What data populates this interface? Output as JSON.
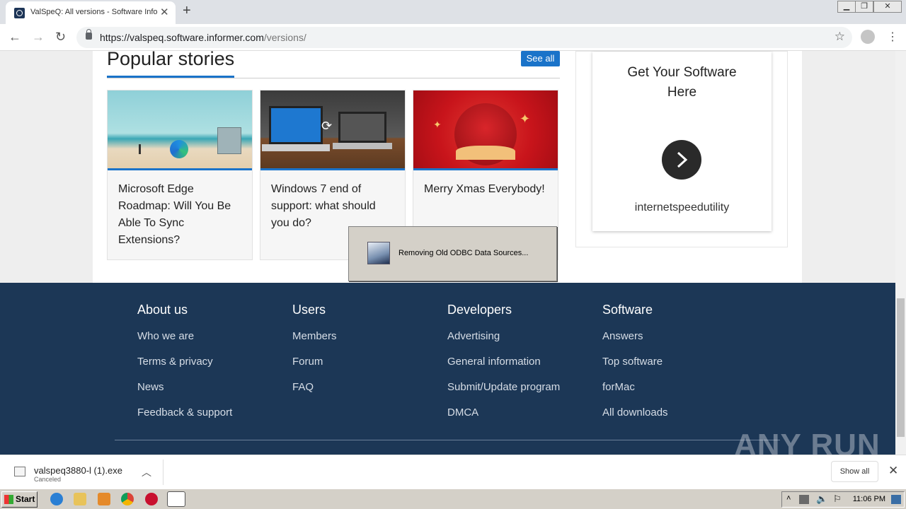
{
  "browser": {
    "tab_title": "ValSpeQ: All versions - Software Informer",
    "url_host": "https://valspeq.software.informer.com",
    "url_path": "/versions/",
    "new_tab": "+"
  },
  "popular": {
    "title": "Popular stories",
    "see_all": "See all",
    "stories": [
      {
        "title": "Microsoft Edge Roadmap: Will You Be Able To Sync Extensions?"
      },
      {
        "title": "Windows 7 end of support: what should you do?"
      },
      {
        "title": "Merry Xmas Everybody!"
      }
    ]
  },
  "sidebar_ad": {
    "title": "Get Your Software Here",
    "app_name": "internetspeedutility"
  },
  "footer": {
    "columns": [
      {
        "heading": "About us",
        "links": [
          "Who we are",
          "Terms & privacy",
          "News",
          "Feedback & support"
        ]
      },
      {
        "heading": "Users",
        "links": [
          "Members",
          "Forum",
          "FAQ"
        ]
      },
      {
        "heading": "Developers",
        "links": [
          "Advertising",
          "General information",
          "Submit/Update program",
          "DMCA"
        ]
      },
      {
        "heading": "Software",
        "links": [
          "Answers",
          "Top software",
          "forMac",
          "All downloads"
        ]
      }
    ],
    "watermark": "ANY RUN"
  },
  "dialog": {
    "message": "Removing Old ODBC Data Sources..."
  },
  "downloads": {
    "file_name": "valspeq3880-l (1).exe",
    "status": "Canceled",
    "show_all": "Show all"
  },
  "taskbar": {
    "start": "Start",
    "clock": "11:06 PM"
  }
}
